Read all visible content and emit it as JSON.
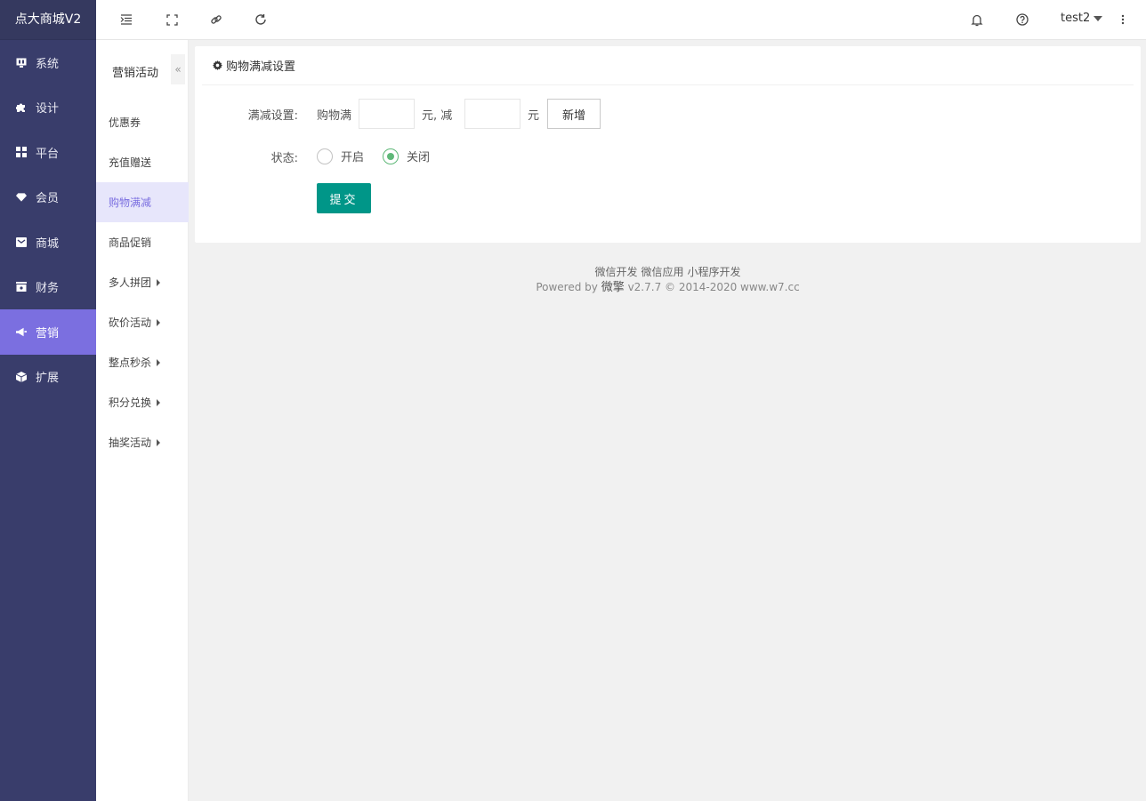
{
  "brand": "点大商城V2",
  "nav": [
    {
      "label": "系统",
      "icon": "monitor-icon"
    },
    {
      "label": "设计",
      "icon": "puzzle-icon"
    },
    {
      "label": "平台",
      "icon": "grid-icon"
    },
    {
      "label": "会员",
      "icon": "diamond-icon"
    },
    {
      "label": "商城",
      "icon": "mail-icon"
    },
    {
      "label": "财务",
      "icon": "wallet-icon"
    },
    {
      "label": "营销",
      "icon": "megaphone-icon",
      "active": true
    },
    {
      "label": "扩展",
      "icon": "cube-icon"
    }
  ],
  "topbar": {
    "user": "test2",
    "icons": [
      "menu-indent-icon",
      "fullscreen-icon",
      "link-icon",
      "refresh-icon",
      "bell-icon",
      "help-icon",
      "more-vertical-icon"
    ]
  },
  "subnav": {
    "title": "营销活动",
    "collapse_label": "«",
    "items": [
      {
        "label": "优惠券"
      },
      {
        "label": "充值赠送"
      },
      {
        "label": "购物满减",
        "active": true
      },
      {
        "label": "商品促销"
      },
      {
        "label": "多人拼团",
        "expandable": true
      },
      {
        "label": "砍价活动",
        "expandable": true
      },
      {
        "label": "整点秒杀",
        "expandable": true
      },
      {
        "label": "积分兑换",
        "expandable": true
      },
      {
        "label": "抽奖活动",
        "expandable": true
      }
    ]
  },
  "card": {
    "title": "购物满减设置",
    "rule_label": "满减设置:",
    "rule_prefix": "购物满",
    "rule_mid": "元, 减",
    "rule_suffix": "元",
    "full_value": "",
    "minus_value": "",
    "add_label": "新增",
    "status_label": "状态:",
    "status_on": "开启",
    "status_off": "关闭",
    "status_selected": "关闭",
    "submit_label": "提交"
  },
  "footer": {
    "links": [
      "微信开发",
      "微信应用",
      "小程序开发"
    ],
    "powered_prefix": "Powered by",
    "powered_brand": "微擎",
    "powered_suffix": "v2.7.7 © 2014-2020 www.w7.cc"
  },
  "colors": {
    "nav_bg": "#393d6b",
    "nav_active": "#7b6fe0",
    "subnav_active_bg": "#e7e6fb",
    "submit_bg": "#009688",
    "radio_on": "#5fb878"
  }
}
